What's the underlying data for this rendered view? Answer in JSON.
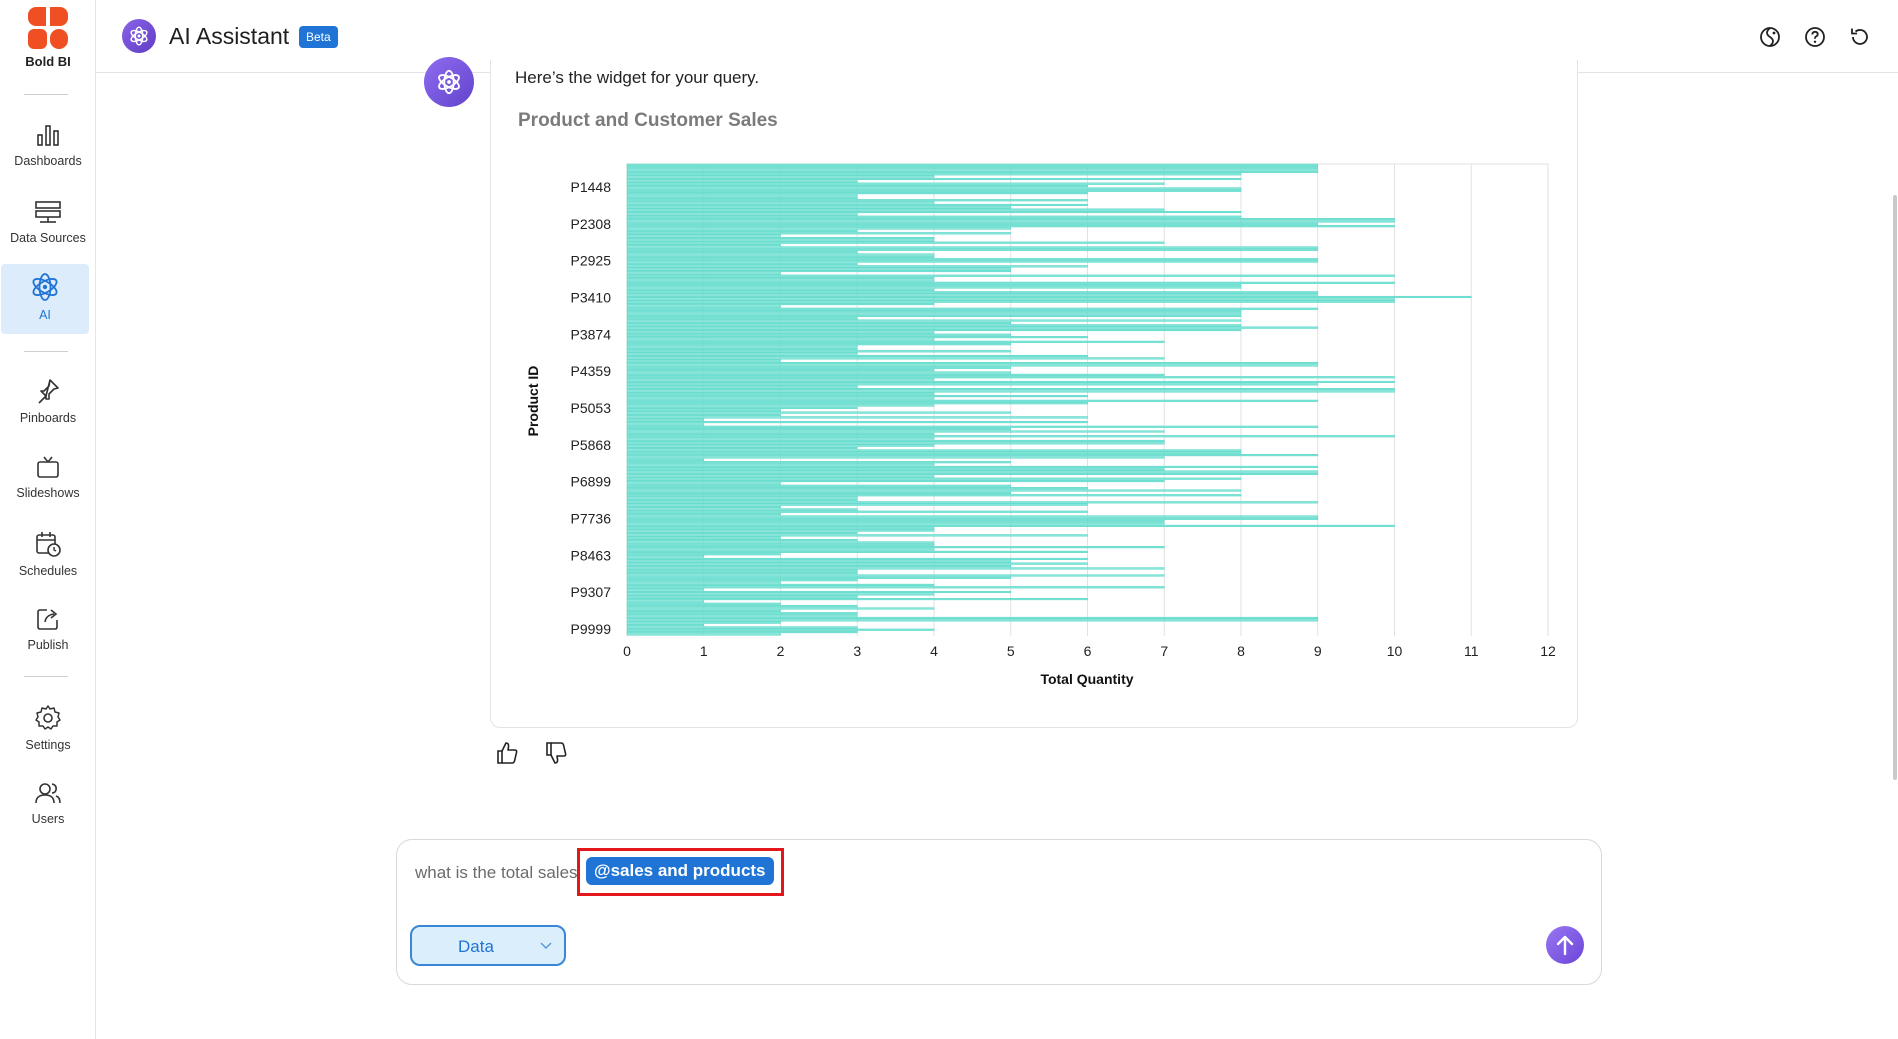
{
  "brand": {
    "name": "Bold BI",
    "colors": {
      "brand": "#f04e23",
      "accent": "#1f74d6",
      "ai_purple": "#7352d9",
      "bar": "#86e5d9",
      "bar_stroke": "#38d0bd"
    }
  },
  "sidebar": {
    "items": [
      {
        "label": "Dashboards",
        "icon": "bar-chart-icon"
      },
      {
        "label": "Data Sources",
        "icon": "database-icon"
      },
      {
        "label": "AI",
        "icon": "atom-icon",
        "active": true
      },
      {
        "label": "Pinboards",
        "icon": "pin-icon"
      },
      {
        "label": "Slideshows",
        "icon": "tv-icon"
      },
      {
        "label": "Schedules",
        "icon": "calendar-clock-icon"
      },
      {
        "label": "Publish",
        "icon": "publish-icon"
      },
      {
        "label": "Settings",
        "icon": "gear-icon"
      },
      {
        "label": "Users",
        "icon": "users-icon"
      }
    ]
  },
  "header": {
    "title": "AI Assistant",
    "badge": "Beta",
    "actions": [
      "theme-icon",
      "help-icon",
      "reset-icon"
    ]
  },
  "chat": {
    "bot_message": "Here’s the widget for your query.",
    "feedback": [
      "thumbs-up-icon",
      "thumbs-down-icon"
    ]
  },
  "input": {
    "query_text": "what is the total sales",
    "mention": "@sales and products",
    "dropdown_selected": "Data"
  },
  "chart_data": {
    "type": "bar",
    "orientation": "horizontal",
    "title": "Product and Customer Sales",
    "xlabel": "Total Quantity",
    "ylabel": "Product ID",
    "xlim": [
      0,
      12
    ],
    "x_ticks": [
      0,
      1,
      2,
      3,
      4,
      5,
      6,
      7,
      8,
      9,
      10,
      11,
      12
    ],
    "y_tick_labels": [
      "P1448",
      "P2308",
      "P2925",
      "P3410",
      "P3874",
      "P4359",
      "P5053",
      "P5868",
      "P6899",
      "P7736",
      "P8463",
      "P9307",
      "P9999"
    ],
    "grid": "vertical",
    "legend": "none",
    "series": [
      {
        "values": [
          9,
          9,
          9,
          9,
          8,
          4,
          8,
          3,
          7,
          6,
          8,
          8,
          6,
          3,
          3,
          6,
          4,
          6,
          5,
          7,
          8,
          3,
          8,
          10,
          10,
          9,
          10,
          5,
          3,
          5,
          2,
          4,
          4,
          7,
          2,
          9,
          9,
          3,
          4,
          4,
          9,
          9,
          3,
          6,
          5,
          5,
          2,
          10,
          4,
          4,
          10,
          8,
          8,
          4,
          9,
          9,
          11,
          10,
          10,
          4,
          2,
          9,
          8,
          8,
          8,
          3,
          8,
          5,
          8,
          9,
          8,
          4,
          5,
          6,
          4,
          7,
          5,
          3,
          3,
          5,
          3,
          6,
          7,
          2,
          9,
          9,
          5,
          4,
          5,
          7,
          10,
          4,
          10,
          9,
          3,
          10,
          10,
          4,
          6,
          4,
          9,
          6,
          4,
          3,
          2,
          5,
          2,
          6,
          1,
          6,
          1,
          9,
          5,
          7,
          4,
          10,
          4,
          7,
          7,
          4,
          3,
          8,
          8,
          9,
          7,
          1,
          5,
          4,
          9,
          7,
          9,
          9,
          4,
          8,
          7,
          2,
          5,
          6,
          8,
          5,
          8,
          3,
          3,
          9,
          6,
          2,
          3,
          6,
          2,
          9,
          9,
          7,
          7,
          10,
          4,
          4,
          3,
          6,
          2,
          3,
          4,
          4,
          7,
          4,
          6,
          2,
          1,
          6,
          5,
          6,
          5,
          7,
          3,
          3,
          7,
          5,
          3,
          2,
          4,
          7,
          1,
          5,
          4,
          3,
          6,
          1,
          2,
          3,
          4,
          2,
          3,
          3,
          9,
          9,
          2,
          1,
          3,
          4,
          3,
          2
        ]
      }
    ]
  }
}
